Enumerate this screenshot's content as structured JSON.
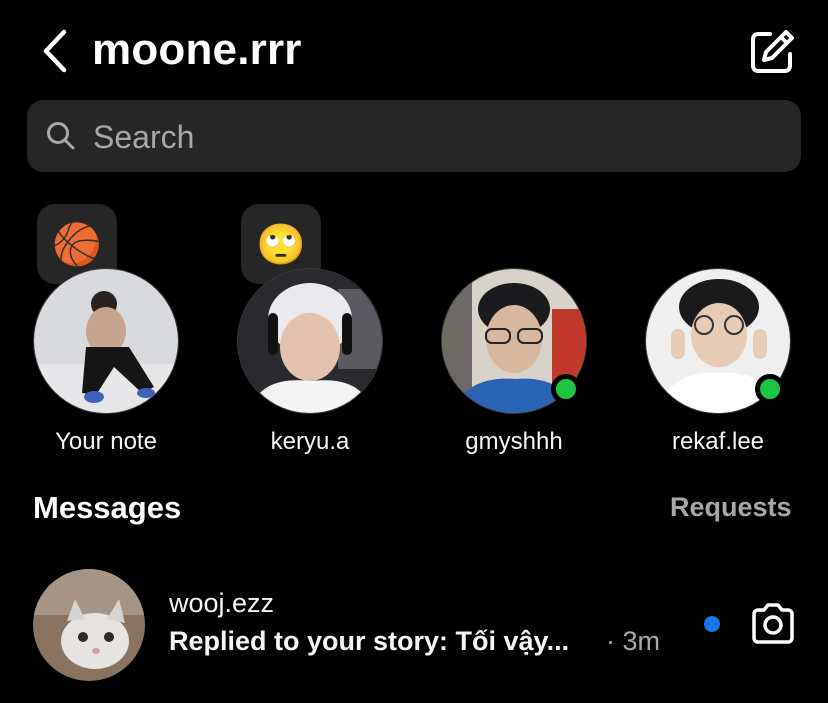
{
  "header": {
    "username": "moone.rrr",
    "back_icon": "chevron-left-icon",
    "compose_icon": "edit-compose-icon"
  },
  "search": {
    "placeholder": "Search",
    "value": "",
    "icon": "search-icon"
  },
  "notes": [
    {
      "name": "Your note",
      "note_emoji": "🏀",
      "online": false
    },
    {
      "name": "keryu.a",
      "note_emoji": "🙄",
      "online": false
    },
    {
      "name": "gmyshhh",
      "note_emoji": "",
      "online": true
    },
    {
      "name": "rekaf.lee",
      "note_emoji": "",
      "online": true
    }
  ],
  "messages_section": {
    "title": "Messages",
    "requests_label": "Requests"
  },
  "messages": [
    {
      "name": "wooj.ezz",
      "preview": "Replied to your story: Tối vậy...",
      "time": "· 3m",
      "unread": true,
      "action_icon": "camera-icon"
    }
  ],
  "colors": {
    "background": "#000000",
    "surface": "#262626",
    "online": "#1ec542",
    "unread": "#1577e8",
    "muted_text": "#a8a8a8"
  }
}
